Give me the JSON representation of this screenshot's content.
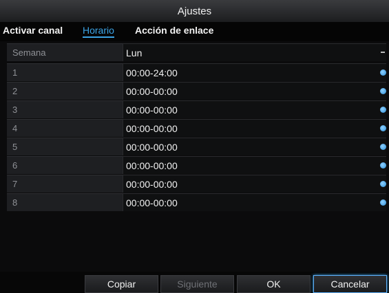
{
  "dialog": {
    "title": "Ajustes"
  },
  "tabs": [
    {
      "label": "Activar canal"
    },
    {
      "label": "Horario"
    },
    {
      "label": "Acción de enlace"
    }
  ],
  "active_tab": "Horario",
  "schedule": {
    "week_label": "Semana",
    "week_value": "Lun",
    "rows": [
      {
        "label": "1",
        "value": "00:00-24:00"
      },
      {
        "label": "2",
        "value": "00:00-00:00"
      },
      {
        "label": "3",
        "value": "00:00-00:00"
      },
      {
        "label": "4",
        "value": "00:00-00:00"
      },
      {
        "label": "5",
        "value": "00:00-00:00"
      },
      {
        "label": "6",
        "value": "00:00-00:00"
      },
      {
        "label": "7",
        "value": "00:00-00:00"
      },
      {
        "label": "8",
        "value": "00:00-00:00"
      }
    ]
  },
  "buttons": {
    "copy": "Copiar",
    "next": "Siguiente",
    "ok": "OK",
    "cancel": "Cancelar"
  },
  "colors": {
    "accent": "#3ca4e6",
    "background": "#0b0b0c"
  },
  "icons": {
    "row_action": "gear-icon",
    "week_select": "chevron-down-icon"
  }
}
